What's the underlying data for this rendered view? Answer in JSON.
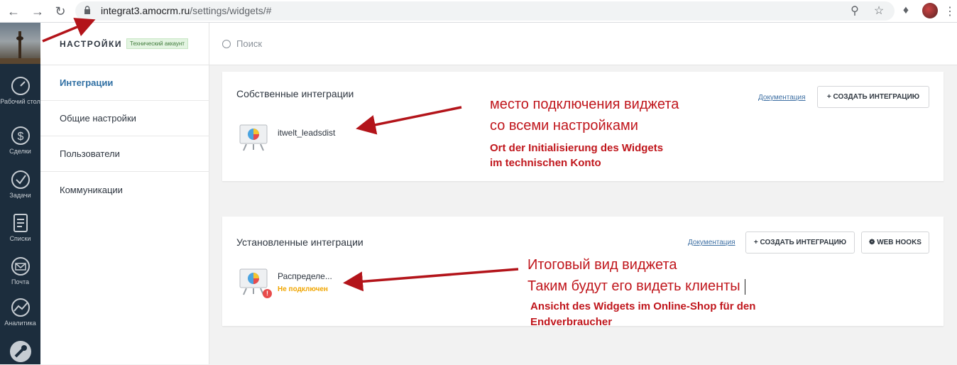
{
  "browser": {
    "url_host": "integrat3.amocrm.ru",
    "url_path": "/settings/widgets/#"
  },
  "left_nav": {
    "items": [
      {
        "label": "Рабочий стол",
        "icon": "dashboard-icon"
      },
      {
        "label": "Сделки",
        "icon": "dollar-icon"
      },
      {
        "label": "Задачи",
        "icon": "check-icon"
      },
      {
        "label": "Списки",
        "icon": "list-icon"
      },
      {
        "label": "Почта",
        "icon": "mail-icon"
      },
      {
        "label": "Аналитика",
        "icon": "analytics-icon"
      },
      {
        "label": "",
        "icon": "wrench-icon"
      }
    ]
  },
  "settings": {
    "title": "НАСТРОЙКИ",
    "badge": "Технический аккаунт",
    "menu": [
      "Интеграции",
      "Общие настройки",
      "Пользователи",
      "Коммуникации"
    ]
  },
  "search": {
    "placeholder": "Поиск"
  },
  "own_integrations": {
    "title": "Собственные интеграции",
    "doc_link": "Документация",
    "create_button": "+ СОЗДАТЬ ИНТЕГРАЦИЮ",
    "widget_name": "itwelt_leadsdist"
  },
  "installed_integrations": {
    "title": "Установленные интеграции",
    "doc_link": "Документация",
    "create_button": "+ СОЗДАТЬ ИНТЕГРАЦИЮ",
    "webhooks_button": "WEB HOOKS",
    "widget_name": "Распределе...",
    "widget_status": "Не подключен",
    "warning_mark": "!"
  },
  "annotations": {
    "own_ru_line1": "место подключения виджета",
    "own_ru_line2": "со всеми настройками",
    "own_de_line1": "Ort der Initialisierung des Widgets",
    "own_de_line2": "im technischen Konto",
    "installed_ru_line1": "Итоговый вид виджета",
    "installed_ru_line2": "Таким будут его видеть клиенты",
    "installed_de_line1": "Ansicht des Widgets im Online-Shop für den",
    "installed_de_line2": "Endverbraucher",
    "color": "#c0161c"
  }
}
